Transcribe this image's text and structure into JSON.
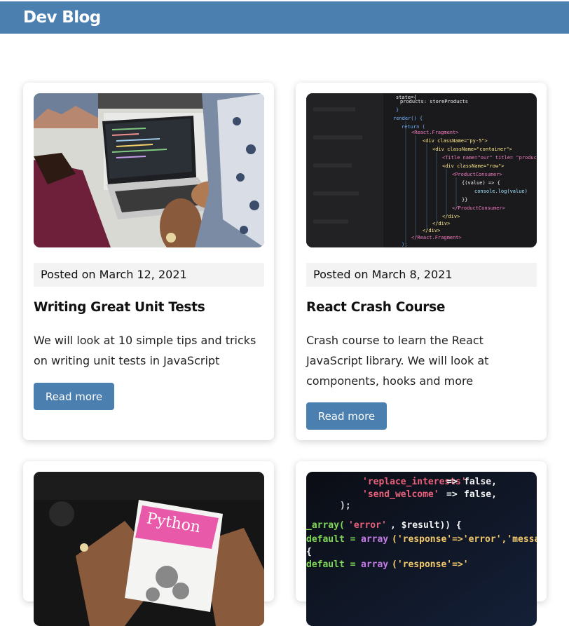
{
  "header": {
    "brand": "Dev Blog",
    "bg_color": "#4a7fb0"
  },
  "posts": [
    {
      "image_icon": "laptop-coding-photo",
      "date": "Posted on March 12, 2021",
      "title": "Writing Great Unit Tests",
      "excerpt": "We will look at 10 simple tips and tricks on writing unit tests in JavaScript",
      "button": "Read more"
    },
    {
      "image_icon": "react-code-screen-photo",
      "date": "Posted on March 8, 2021",
      "title": "React Crash Course",
      "excerpt": "Crash course to learn the React JavaScript library. We will look at components, hooks and more",
      "button": "Read more"
    },
    {
      "image_icon": "python-book-photo",
      "image_text": "Python",
      "date": "",
      "title": "",
      "excerpt": "",
      "button": ""
    },
    {
      "image_icon": "php-code-screen-photo",
      "date": "",
      "title": "",
      "excerpt": "",
      "button": ""
    }
  ],
  "code_snippets": {
    "react": [
      "state={",
      "  products: storeProducts",
      "}",
      "render() {",
      "  return (",
      "    <React.Fragment>",
      "      <div className=\"py-5\">",
      "        <div className=\"container\">",
      "          <Title name=\"our\" title= \"product",
      "          <div className=\"row\">",
      "            <ProductConsumer>",
      "              {(value) => {",
      "                console.log(value)",
      "              }}",
      "            </ProductConsumer>",
      "          </div>",
      "        </div>",
      "      </div>",
      "    </React.Fragment>",
      "  );"
    ],
    "php": [
      "'replace_interests' => false,",
      "'send_welcome'      => false,",
      ");",
      "__array('error', $result)) {",
      "  default = array('response'=>'error','message'",
      "  {",
      "  default = array('response'=>'"
    ]
  }
}
